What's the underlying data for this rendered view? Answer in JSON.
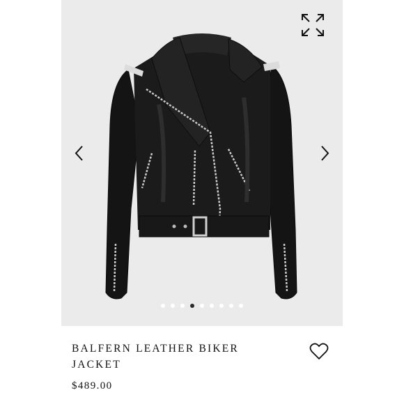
{
  "product": {
    "name_line1": "BALFERN LEATHER BIKER",
    "name_line2": "JACKET",
    "price": "$489.00"
  },
  "gallery": {
    "image": "black-leather-biker-jacket",
    "background_color": "#ebebeb",
    "slide_count": 9,
    "active_slide": 4
  },
  "icons": {
    "expand": "expand-icon",
    "prev": "chevron-left-icon",
    "next": "chevron-right-icon",
    "wishlist": "heart-outline-icon"
  }
}
